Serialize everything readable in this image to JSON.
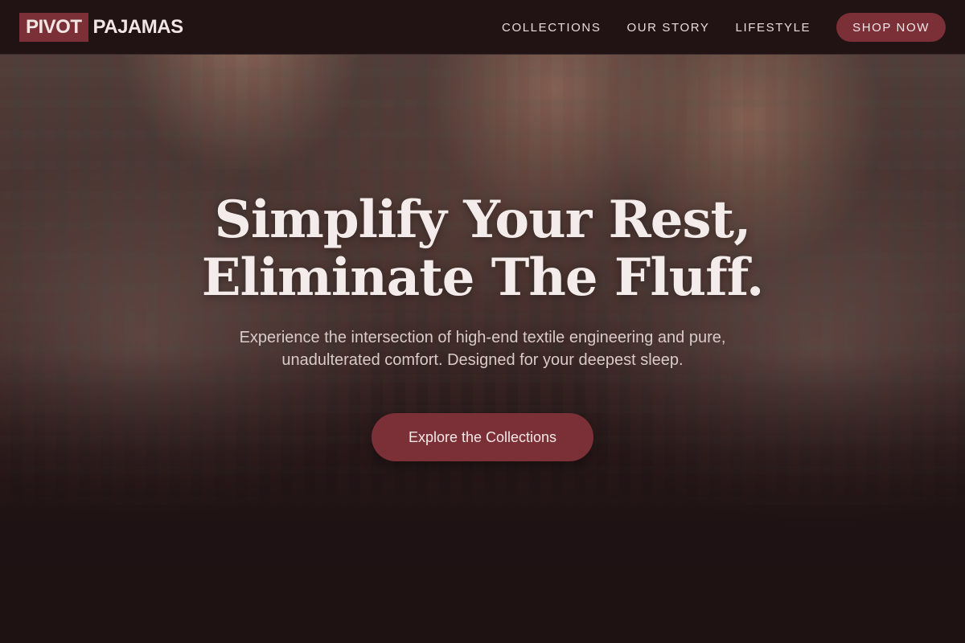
{
  "brand": {
    "logo_box_text": "PIVOT",
    "logo_text": "PAJAMAS"
  },
  "nav": {
    "items": [
      {
        "label": "COLLECTIONS"
      },
      {
        "label": "OUR STORY"
      },
      {
        "label": "LIFESTYLE"
      }
    ],
    "cta_label": "SHOP NOW"
  },
  "hero": {
    "title_line1": "Simplify Your Rest,",
    "title_line2": "Eliminate The Fluff.",
    "subtitle": "Experience the intersection of high-end textile engineering and pure, unadulterated comfort. Designed for your deepest sleep.",
    "cta_label": "Explore the Collections",
    "image_description": "family-in-matching-fair-isle-pajamas"
  },
  "colors": {
    "accent": "#7a3036",
    "header_bg": "#211314",
    "page_bg": "#1e1213",
    "text_light": "#f3ecea"
  }
}
